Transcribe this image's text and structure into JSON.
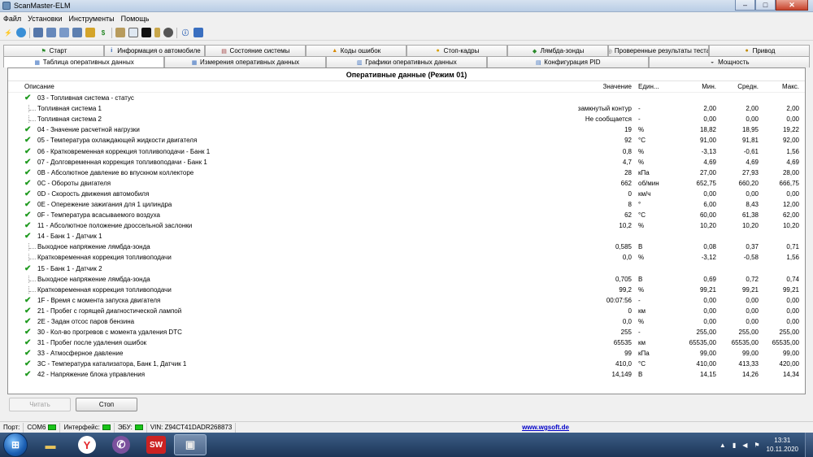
{
  "window": {
    "title": "ScanMaster-ELM",
    "min": "–",
    "max": "□",
    "close": "✕"
  },
  "menu": [
    "Файл",
    "Установки",
    "Инструменты",
    "Помощь"
  ],
  "tabs_row1": [
    {
      "label": "Старт",
      "icon": "flag-icon"
    },
    {
      "label": "Информация о автомобиле",
      "icon": "info-icon"
    },
    {
      "label": "Состояние системы",
      "icon": "checklist-icon"
    },
    {
      "label": "Коды ошибок",
      "icon": "warning-icon"
    },
    {
      "label": "Стоп-кадры",
      "icon": "stop-frame-icon"
    },
    {
      "label": "Лямбда-зонды",
      "icon": "lambda-icon"
    },
    {
      "label": "Проверенные результаты теста",
      "icon": "test-icon"
    },
    {
      "label": "Привод",
      "icon": "drive-icon"
    }
  ],
  "tabs_row2": [
    {
      "label": "Таблица оперативных данных",
      "icon": "table-icon",
      "active": true
    },
    {
      "label": "Измерения оперативных данных",
      "icon": "gauge-icon",
      "active": false
    },
    {
      "label": "Графики оперативных данных",
      "icon": "chart-icon",
      "active": false
    },
    {
      "label": "Конфигурация PID",
      "icon": "config-icon",
      "active": false
    },
    {
      "label": "Мощность",
      "icon": "power-icon",
      "active": false
    }
  ],
  "grid": {
    "title": "Оперативные данные (Режим 01)",
    "columns": {
      "desc": "Описание",
      "value": "Значение",
      "unit": "Един...",
      "min": "Мин.",
      "avg": "Средн.",
      "max": "Макс."
    },
    "rows": [
      {
        "chk": true,
        "sub": false,
        "desc": "03 - Топливная система - статус",
        "value": "",
        "unit": "",
        "min": "",
        "avg": "",
        "max": ""
      },
      {
        "chk": false,
        "sub": true,
        "desc": "Топливная система 1",
        "value": "замкнутый контур",
        "unit": "-",
        "min": "2,00",
        "avg": "2,00",
        "max": "2,00"
      },
      {
        "chk": false,
        "sub": true,
        "desc": "Топливная система 2",
        "value": "Не сообщается",
        "unit": "-",
        "min": "0,00",
        "avg": "0,00",
        "max": "0,00"
      },
      {
        "chk": true,
        "sub": false,
        "desc": "04 - Значение расчетной нагрузки",
        "value": "19",
        "unit": "%",
        "min": "18,82",
        "avg": "18,95",
        "max": "19,22"
      },
      {
        "chk": true,
        "sub": false,
        "desc": "05 - Температура охлаждающей жидкости двигателя",
        "value": "92",
        "unit": "°C",
        "min": "91,00",
        "avg": "91,81",
        "max": "92,00"
      },
      {
        "chk": true,
        "sub": false,
        "desc": "06 - Кратковременная коррекция топливоподачи - Банк 1",
        "value": "0,8",
        "unit": "%",
        "min": "-3,13",
        "avg": "-0,61",
        "max": "1,56"
      },
      {
        "chk": true,
        "sub": false,
        "desc": "07 - Долговременная коррекция топливоподачи - Банк 1",
        "value": "4,7",
        "unit": "%",
        "min": "4,69",
        "avg": "4,69",
        "max": "4,69"
      },
      {
        "chk": true,
        "sub": false,
        "desc": "0B - Абсолютное давление во впускном коллекторе",
        "value": "28",
        "unit": "кПа",
        "min": "27,00",
        "avg": "27,93",
        "max": "28,00"
      },
      {
        "chk": true,
        "sub": false,
        "desc": "0C - Обороты двигателя",
        "value": "662",
        "unit": "об/мин",
        "min": "652,75",
        "avg": "660,20",
        "max": "666,75"
      },
      {
        "chk": true,
        "sub": false,
        "desc": "0D - Скорость движения автомобиля",
        "value": "0",
        "unit": "км/ч",
        "min": "0,00",
        "avg": "0,00",
        "max": "0,00"
      },
      {
        "chk": true,
        "sub": false,
        "desc": "0E - Опережение зажигания для 1 цилиндра",
        "value": "8",
        "unit": "°",
        "min": "6,00",
        "avg": "8,43",
        "max": "12,00"
      },
      {
        "chk": true,
        "sub": false,
        "desc": "0F - Температура всасываемого воздуха",
        "value": "62",
        "unit": "°C",
        "min": "60,00",
        "avg": "61,38",
        "max": "62,00"
      },
      {
        "chk": true,
        "sub": false,
        "desc": "11 - Абсолютное положение дроссельной заслонки",
        "value": "10,2",
        "unit": "%",
        "min": "10,20",
        "avg": "10,20",
        "max": "10,20"
      },
      {
        "chk": true,
        "sub": false,
        "desc": "14 - Банк 1 - Датчик 1",
        "value": "",
        "unit": "",
        "min": "",
        "avg": "",
        "max": ""
      },
      {
        "chk": false,
        "sub": true,
        "desc": "Выходное напряжение лямбда-зонда",
        "value": "0,585",
        "unit": "В",
        "min": "0,08",
        "avg": "0,37",
        "max": "0,71"
      },
      {
        "chk": false,
        "sub": true,
        "desc": "Кратковременная коррекция топливоподачи",
        "value": "0,0",
        "unit": "%",
        "min": "-3,12",
        "avg": "-0,58",
        "max": "1,56"
      },
      {
        "chk": true,
        "sub": false,
        "desc": "15 - Банк 1 - Датчик 2",
        "value": "",
        "unit": "",
        "min": "",
        "avg": "",
        "max": ""
      },
      {
        "chk": false,
        "sub": true,
        "desc": "Выходное напряжение лямбда-зонда",
        "value": "0,705",
        "unit": "В",
        "min": "0,69",
        "avg": "0,72",
        "max": "0,74"
      },
      {
        "chk": false,
        "sub": true,
        "desc": "Кратковременная коррекция топливоподачи",
        "value": "99,2",
        "unit": "%",
        "min": "99,21",
        "avg": "99,21",
        "max": "99,21"
      },
      {
        "chk": true,
        "sub": false,
        "desc": "1F - Время с момента запуска двигателя",
        "value": "00:07:56",
        "unit": "-",
        "min": "0,00",
        "avg": "0,00",
        "max": "0,00"
      },
      {
        "chk": true,
        "sub": false,
        "desc": "21 - Пробег с горящей диагностической лампой",
        "value": "0",
        "unit": "км",
        "min": "0,00",
        "avg": "0,00",
        "max": "0,00"
      },
      {
        "chk": true,
        "sub": false,
        "desc": "2E - Задан отсос паров бензина",
        "value": "0,0",
        "unit": "%",
        "min": "0,00",
        "avg": "0,00",
        "max": "0,00"
      },
      {
        "chk": true,
        "sub": false,
        "desc": "30 - Кол-во прогревов с момента удаления DTC",
        "value": "255",
        "unit": "-",
        "min": "255,00",
        "avg": "255,00",
        "max": "255,00"
      },
      {
        "chk": true,
        "sub": false,
        "desc": "31 - Пробег после удаления ошибок",
        "value": "65535",
        "unit": "км",
        "min": "65535,00",
        "avg": "65535,00",
        "max": "65535,00"
      },
      {
        "chk": true,
        "sub": false,
        "desc": "33 - Атмосферное давление",
        "value": "99",
        "unit": "кПа",
        "min": "99,00",
        "avg": "99,00",
        "max": "99,00"
      },
      {
        "chk": true,
        "sub": false,
        "desc": "3C - Температура катализатора, Банк 1, Датчик 1",
        "value": "410,0",
        "unit": "°C",
        "min": "410,00",
        "avg": "413,33",
        "max": "420,00"
      },
      {
        "chk": true,
        "sub": false,
        "desc": "42 - Напряжение блока управления",
        "value": "14,149",
        "unit": "В",
        "min": "14,15",
        "avg": "14,26",
        "max": "14,34"
      }
    ]
  },
  "buttons": {
    "read": "Читать",
    "stop": "Стоп"
  },
  "status": {
    "port_label": "Порт:",
    "port": "COM6",
    "interface_label": "Интерфейс:",
    "ecu_label": "ЭБУ:",
    "vin": "VIN: Z94CT41DADR268873",
    "site": "www.wgsoft.de"
  },
  "clock": {
    "time": "13:31",
    "date": "10.11.2020"
  },
  "taskbar": [
    "folder-icon",
    "yandex-icon",
    "viber-icon",
    "sw-icon",
    "scanmaster-icon"
  ],
  "colors": {
    "check": "#1f9a1f",
    "led": "#19c419",
    "link": "#0000c8"
  }
}
